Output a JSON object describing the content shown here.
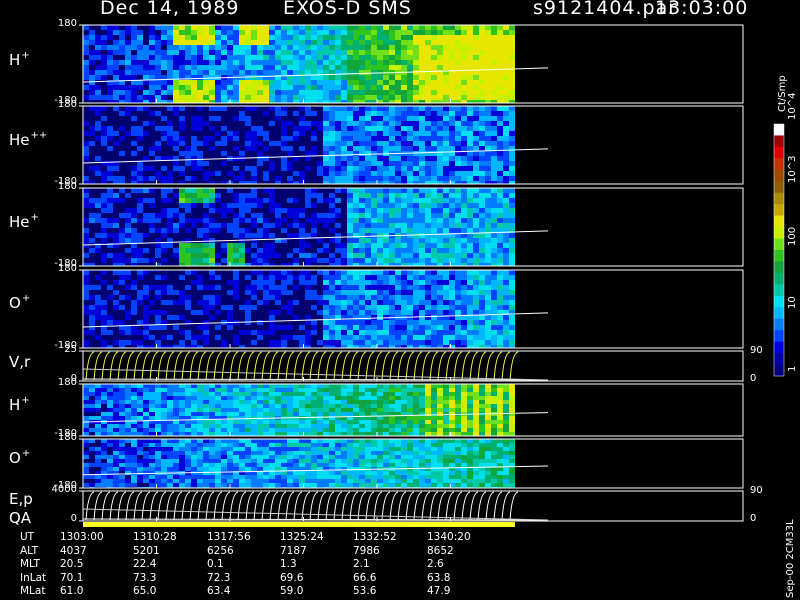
{
  "header": {
    "date": "Dec 14, 1989",
    "mission": "EXOS-D SMS",
    "file": "s9121404.par",
    "time": "13:03:00"
  },
  "colorbar": {
    "unit": "Ct/Smp",
    "tick_labels": [
      "1",
      "10",
      "100",
      "10^3",
      "10^4"
    ],
    "colors": [
      "#00007e",
      "#0000a8",
      "#0000d8",
      "#0044ff",
      "#007dff",
      "#00b7ff",
      "#00dfef",
      "#00c8a8",
      "#00b070",
      "#11a53c",
      "#2ec31e",
      "#6fe01a",
      "#c6f000",
      "#e6e600",
      "#c8a800",
      "#a88c00",
      "#8c5f00",
      "#a04a00",
      "#c83000",
      "#e00000",
      "#a00000",
      "#ffffff"
    ]
  },
  "chart_data": {
    "type": "heatmap",
    "xlabel": "UT",
    "x_ticks": [
      "1303:00",
      "1310:28",
      "1317:56",
      "1325:24",
      "1332:52",
      "1340:20"
    ],
    "panels": [
      {
        "species": "H",
        "charge": "+",
        "ylim": [
          -180,
          180
        ],
        "ytick_top": "180",
        "ytick_bottom": "-180",
        "kind": "spectrogram"
      },
      {
        "species": "He",
        "charge": "++",
        "ylim": [
          -180,
          180
        ],
        "ytick_top": "180",
        "ytick_bottom": "-180",
        "kind": "spectrogram"
      },
      {
        "species": "He",
        "charge": "+",
        "ylim": [
          -180,
          180
        ],
        "ytick_top": "180",
        "ytick_bottom": "-180",
        "kind": "spectrogram"
      },
      {
        "species": "O",
        "charge": "+",
        "ylim": [
          -180,
          180
        ],
        "ytick_top": "180",
        "ytick_bottom": "-180",
        "kind": "spectrogram"
      },
      {
        "species": "V,r",
        "charge": "",
        "ylim": [
          0,
          25
        ],
        "ytick_top": "25",
        "ytick_bottom": "0",
        "right_ticks": [
          "90",
          "0"
        ],
        "kind": "line"
      },
      {
        "species": "H",
        "charge": "+",
        "ylim": [
          -180,
          180
        ],
        "ytick_top": "180",
        "ytick_bottom": "-180",
        "kind": "spectrogram"
      },
      {
        "species": "O",
        "charge": "+",
        "ylim": [
          -180,
          180
        ],
        "ytick_top": "180",
        "ytick_bottom": "-180",
        "kind": "spectrogram"
      },
      {
        "species": "E,p",
        "charge": "",
        "ylim": [
          0,
          4000
        ],
        "ytick_top": "4000",
        "ytick_bottom": "0",
        "right_ticks": [
          "90",
          "0"
        ],
        "kind": "line"
      }
    ],
    "qa_label": "QA"
  },
  "table": {
    "rows": [
      {
        "label": "UT",
        "values": [
          "1303:00",
          "1310:28",
          "1317:56",
          "1325:24",
          "1332:52",
          "1340:20"
        ]
      },
      {
        "label": "ALT",
        "values": [
          "4037",
          "5201",
          "6256",
          "7187",
          "7986",
          "8652"
        ]
      },
      {
        "label": "MLT",
        "values": [
          "20.5",
          "22.4",
          "0.1",
          "1.3",
          "2.1",
          "2.6"
        ]
      },
      {
        "label": "InLat",
        "values": [
          "70.1",
          "73.3",
          "72.3",
          "69.6",
          "66.6",
          "63.8"
        ]
      },
      {
        "label": "MLat",
        "values": [
          "61.0",
          "65.0",
          "63.4",
          "59.0",
          "53.6",
          "47.9"
        ]
      }
    ]
  },
  "footer_stamp": "Sep-00 2CM33L"
}
